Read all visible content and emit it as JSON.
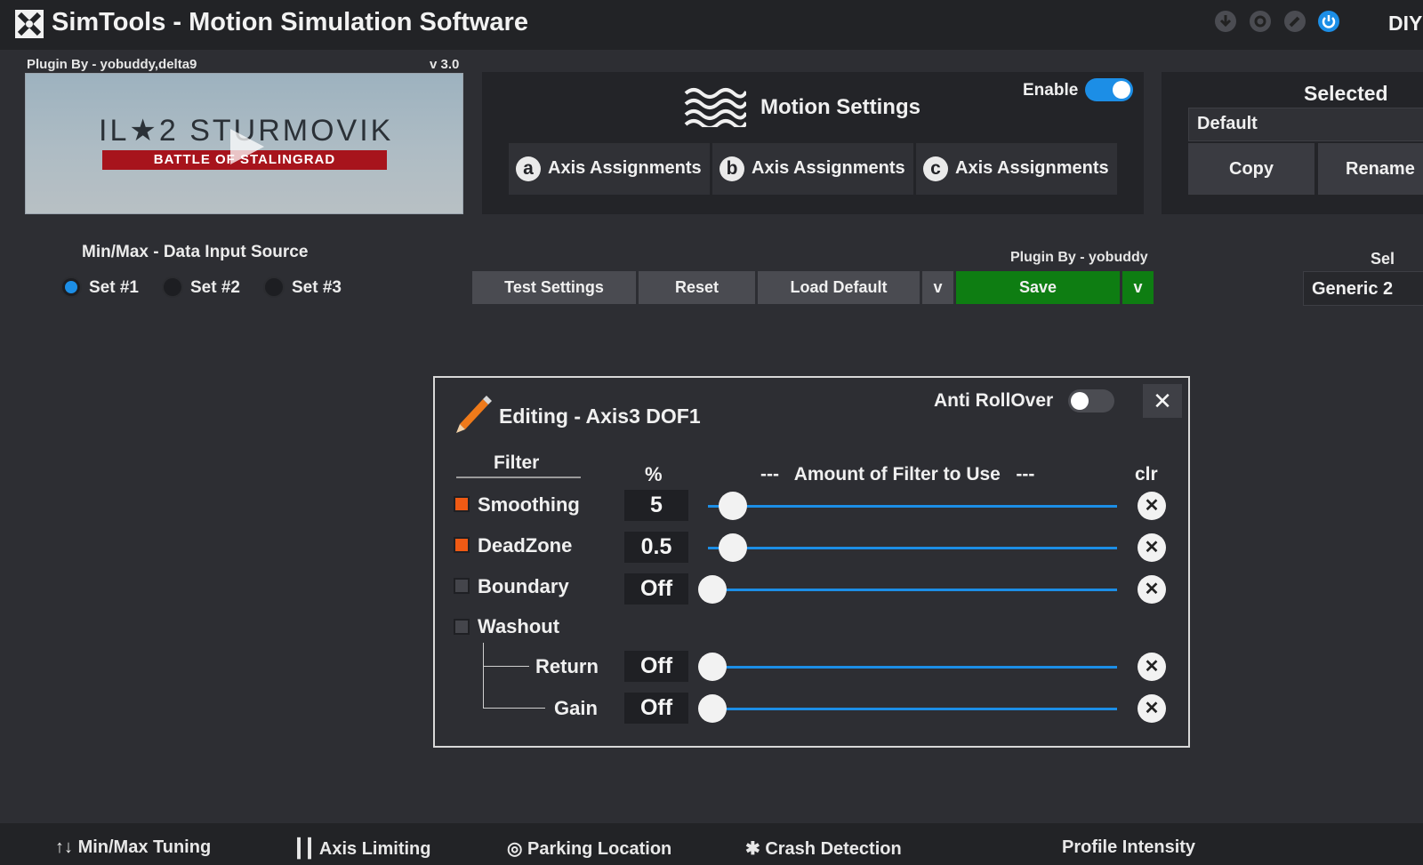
{
  "window": {
    "title": "SimTools - Motion Simulation Software",
    "diy_label": "DIY"
  },
  "plugin": {
    "author_label": "Plugin By - yobuddy,delta9",
    "version": "v 3.0",
    "game_title": "IL★2 STURMOVIK",
    "game_subtitle": "BATTLE OF STALINGRAD"
  },
  "motion_settings": {
    "title": "Motion Settings",
    "enable_label": "Enable",
    "enabled": true,
    "tabs": [
      {
        "letter": "a",
        "label": "Axis Assignments"
      },
      {
        "letter": "b",
        "label": "Axis Assignments"
      },
      {
        "letter": "c",
        "label": "Axis Assignments"
      }
    ]
  },
  "selected": {
    "title": "Selected",
    "profile": "Default",
    "copy_label": "Copy",
    "rename_label": "Rename"
  },
  "minmax": {
    "label": "Min/Max - Data Input Source",
    "options": [
      "Set #1",
      "Set #2",
      "Set #3"
    ],
    "selected": "Set #1"
  },
  "actions": {
    "plugin_by": "Plugin By - yobuddy",
    "test_label": "Test Settings",
    "reset_label": "Reset",
    "load_default_label": "Load Default",
    "dropdown_glyph": "v",
    "save_label": "Save",
    "sel_label": "Sel",
    "generic_value": "Generic 2"
  },
  "editor": {
    "title": "Editing - Axis3 DOF1",
    "anti_rollover_label": "Anti RollOver",
    "anti_rollover_on": false,
    "close_glyph": "✕",
    "filter_header": "Filter",
    "pct_header": "%",
    "amount_header": "---   Amount of Filter to Use   ---",
    "clr_header": "clr",
    "clear_glyph": "✕",
    "filters": [
      {
        "name": "Smoothing",
        "checked": true,
        "value": "5",
        "level": 0.05
      },
      {
        "name": "DeadZone",
        "checked": true,
        "value": "0.5",
        "level": 0.05
      },
      {
        "name": "Boundary",
        "checked": false,
        "value": "Off",
        "level": 0
      },
      {
        "name": "Washout",
        "checked": false
      }
    ],
    "washout_sub": [
      {
        "name": "Return",
        "value": "Off",
        "level": 0
      },
      {
        "name": "Gain",
        "value": "Off",
        "level": 0
      }
    ]
  },
  "bottom_tabs": [
    "Min/Max Tuning",
    "Axis Limiting",
    "Parking Location",
    "Crash Detection",
    "Profile Intensity"
  ],
  "colors": {
    "accent": "#1c8ee6",
    "save_green": "#0e7d12",
    "checked_orange": "#ef5a14"
  }
}
